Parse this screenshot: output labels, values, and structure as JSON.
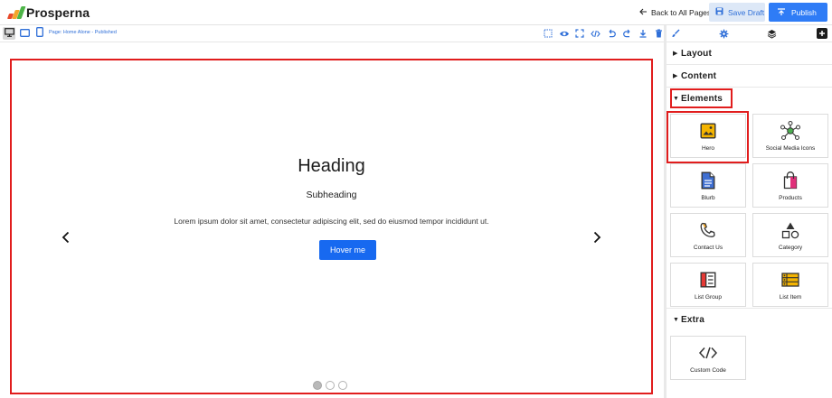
{
  "app": {
    "brand": "Prosperna",
    "back_label": "Back to All Pages",
    "save_draft_label": "Save Draft",
    "publish_label": "Publish"
  },
  "toolbar": {
    "page_label": "Page: Home Alone - Published",
    "devices": [
      "desktop-icon",
      "tablet-icon",
      "mobile-icon"
    ],
    "tools": [
      "select-icon",
      "eye-icon",
      "fullscreen-icon",
      "code-icon",
      "undo-icon",
      "redo-icon",
      "download-icon",
      "trash-icon"
    ]
  },
  "hero": {
    "heading": "Heading",
    "subheading": "Subheading",
    "text": "Lorem ipsum dolor sit amet, consectetur adipiscing elit, sed do eiusmod tempor incididunt ut.",
    "button_label": "Hover me",
    "slides_total": 3,
    "active_slide": 1
  },
  "panel": {
    "tabs": [
      "brush-icon",
      "gear-icon",
      "layers-icon"
    ],
    "sections": {
      "layout": "Layout",
      "content": "Content",
      "elements": "Elements",
      "extra": "Extra"
    },
    "element_tiles": [
      {
        "label": "Hero",
        "icon": "image-icon"
      },
      {
        "label": "Social Media Icons",
        "icon": "network-icon"
      },
      {
        "label": "Blurb",
        "icon": "document-icon"
      },
      {
        "label": "Products",
        "icon": "shopping-bag-icon"
      },
      {
        "label": "Contact Us",
        "icon": "phone-icon"
      },
      {
        "label": "Category",
        "icon": "shapes-icon"
      },
      {
        "label": "List Group",
        "icon": "list-group-icon"
      },
      {
        "label": "List Item",
        "icon": "list-item-icon"
      }
    ],
    "extra_tiles": [
      {
        "label": "Custom Code",
        "icon": "code-brackets-icon"
      }
    ]
  },
  "colors": {
    "accent": "#2f7cf6",
    "highlight": "#e11d1d",
    "button": "#1769f0"
  }
}
